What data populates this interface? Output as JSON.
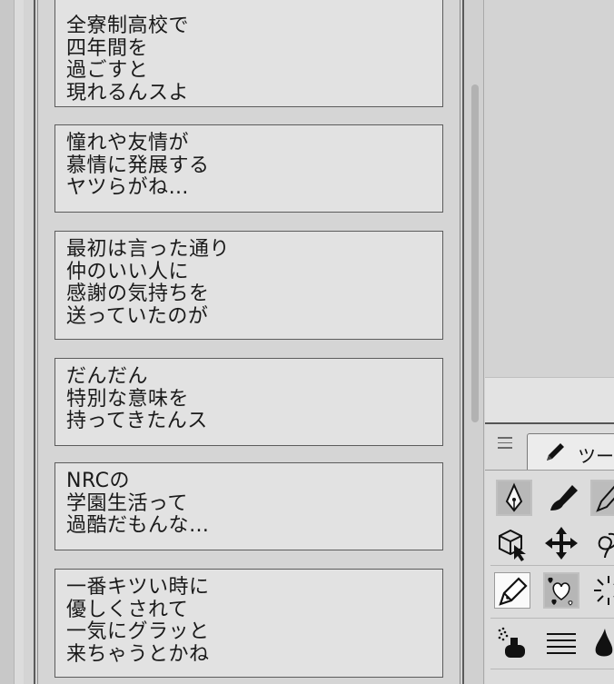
{
  "memos": [
    {
      "lines": [
        "全寮制高校で",
        "四年間を",
        "過ごすと",
        "現れるんスよ"
      ]
    },
    {
      "lines": [
        "憧れや友情が",
        "慕情に発展する",
        "ヤツらがね…"
      ]
    },
    {
      "lines": [
        "最初は言った通り",
        "仲のいい人に",
        "感謝の気持ちを",
        "送っていたのが"
      ]
    },
    {
      "lines": [
        "だんだん",
        "特別な意味を",
        "持ってきたんス"
      ]
    },
    {
      "lines": [
        "NRCの",
        "学園生活って",
        "過酷だもんな…"
      ]
    },
    {
      "lines": [
        "一番キツい時に",
        "優しくされて",
        "一気にグラッと",
        "来ちゃうとかね"
      ]
    }
  ],
  "tool_panel": {
    "tab_label": "ツー",
    "icons": [
      "menu-icon",
      "pen-icon",
      "fountain-pen-nib-icon",
      "brush-icon",
      "pencil-icon",
      "operation-select-icon",
      "move-icon",
      "lasso-icon",
      "pen-tool-icon",
      "decoration-hearts-icon",
      "burst-lines-icon",
      "airbrush-icon",
      "lines-icon",
      "drop-icon"
    ]
  }
}
